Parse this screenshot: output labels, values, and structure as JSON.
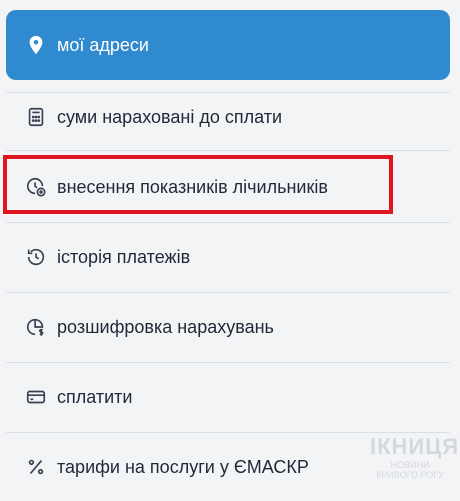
{
  "menu": {
    "items": [
      {
        "label": "мої адреси",
        "icon": "location-pin-icon",
        "active": true
      },
      {
        "label": "суми нараховані до сплати",
        "icon": "calculator-icon",
        "active": false
      },
      {
        "label": "внесення показників лічильників",
        "icon": "meter-add-icon",
        "active": false
      },
      {
        "label": "історія платежів",
        "icon": "history-icon",
        "active": false
      },
      {
        "label": "розшифровка нарахувань",
        "icon": "charges-breakdown-icon",
        "active": false
      },
      {
        "label": "сплатити",
        "icon": "credit-card-icon",
        "active": false
      },
      {
        "label": "тарифи на послуги у ЄМАСКР",
        "icon": "percent-icon",
        "active": false
      }
    ]
  },
  "colors": {
    "active_bg": "#2f8ad0",
    "highlight_border": "#e0161f",
    "text": "#1f2937"
  },
  "watermark": {
    "logo_text": "ІКНИЦЯ",
    "caption": "НОВИНИ КРИВОГО РОГУ"
  }
}
